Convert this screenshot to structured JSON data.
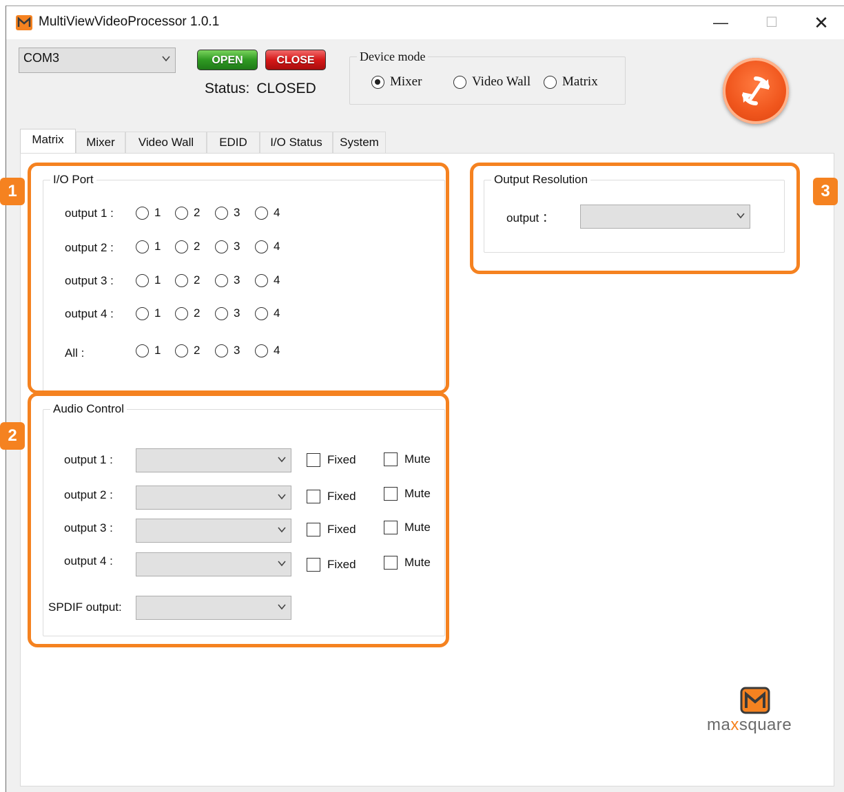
{
  "window": {
    "title": "MultiViewVideoProcessor 1.0.1",
    "min_glyph": "—",
    "max_glyph": "☐",
    "close_glyph": "✕"
  },
  "toolbar": {
    "com_port": "COM3",
    "open_label": "OPEN",
    "close_label": "CLOSE",
    "status_label": "Status:",
    "status_value": "CLOSED"
  },
  "device_mode": {
    "legend": "Device mode",
    "options": [
      {
        "label": "Mixer",
        "checked": true
      },
      {
        "label": "Video Wall",
        "checked": false
      },
      {
        "label": "Matrix",
        "checked": false
      }
    ]
  },
  "tabs": [
    {
      "label": "Matrix",
      "active": true
    },
    {
      "label": "Mixer",
      "active": false
    },
    {
      "label": "Video Wall",
      "active": false
    },
    {
      "label": "EDID",
      "active": false
    },
    {
      "label": "I/O Status",
      "active": false
    },
    {
      "label": "System",
      "active": false
    }
  ],
  "io_port": {
    "legend": "I/O Port",
    "rows": [
      {
        "label": "output 1 :",
        "options": [
          "1",
          "2",
          "3",
          "4"
        ]
      },
      {
        "label": "output 2 :",
        "options": [
          "1",
          "2",
          "3",
          "4"
        ]
      },
      {
        "label": "output 3 :",
        "options": [
          "1",
          "2",
          "3",
          "4"
        ]
      },
      {
        "label": "output 4 :",
        "options": [
          "1",
          "2",
          "3",
          "4"
        ]
      },
      {
        "label": "All :",
        "options": [
          "1",
          "2",
          "3",
          "4"
        ]
      }
    ]
  },
  "audio_control": {
    "legend": "Audio Control",
    "fixed_label": "Fixed",
    "mute_label": "Mute",
    "rows": [
      {
        "label": "output 1 :",
        "value": ""
      },
      {
        "label": "output 2 :",
        "value": ""
      },
      {
        "label": "output 3 :",
        "value": ""
      },
      {
        "label": "output 4 :",
        "value": ""
      }
    ],
    "spdif_label": "SPDIF output:",
    "spdif_value": ""
  },
  "output_resolution": {
    "legend": "Output Resolution",
    "label": "output ：",
    "value": ""
  },
  "annotations": {
    "badges": [
      "1",
      "2",
      "3"
    ],
    "color": "#f58220"
  },
  "logo": {
    "text_pre": "ma",
    "text_x": "x",
    "text_post": "square"
  },
  "colors": {
    "accent": "#f58220",
    "open_green": "#2f9a22",
    "close_red": "#d61818",
    "refresh_orange": "#f0561d"
  },
  "icons": [
    "app-icon",
    "chevron-down-icon",
    "refresh-icon",
    "maxsquare-logo-icon"
  ]
}
